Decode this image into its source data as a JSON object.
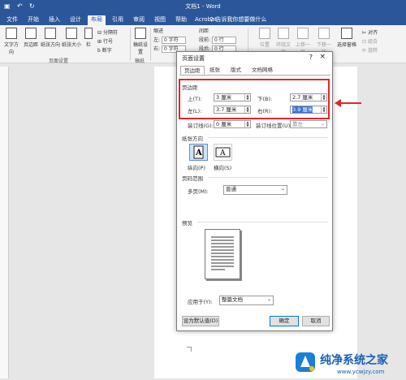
{
  "titlebar": {
    "doc_title": "文档1 - Word",
    "quick_icons": [
      "save-icon",
      "undo-icon",
      "redo-icon"
    ]
  },
  "tabs": [
    {
      "label": "文件"
    },
    {
      "label": "开始"
    },
    {
      "label": "插入"
    },
    {
      "label": "设计"
    },
    {
      "label": "布局"
    },
    {
      "label": "引用"
    },
    {
      "label": "审阅"
    },
    {
      "label": "视图"
    },
    {
      "label": "帮助"
    },
    {
      "label": "Acrobat"
    }
  ],
  "active_tab": "布局",
  "tell_me": "告诉我你想要做什么",
  "ribbon": {
    "page_setup": {
      "buttons": [
        "文字方向",
        "页边距",
        "纸张方向",
        "纸张大小",
        "栏"
      ],
      "small": [
        "分隔符",
        "行号",
        "断字"
      ],
      "label": "页面设置"
    },
    "draft": {
      "button": "稿纸设置",
      "label": "稿纸"
    },
    "indent": {
      "title": "缩进",
      "left_label": "左:",
      "left_val": "0 字符",
      "right_label": "右:",
      "right_val": "0 字符"
    },
    "spacing": {
      "title": "间距",
      "before_label": "段前:",
      "before_val": "0 行",
      "after_label": "段后:",
      "after_val": "0 行"
    },
    "arrange": [
      "位置",
      "环绕文字",
      "上移一层",
      "下移一层",
      "选择窗格"
    ],
    "align": [
      "对齐",
      "组合",
      "旋转"
    ]
  },
  "dialog": {
    "title": "页面设置",
    "help": "?",
    "close": "×",
    "tabs": [
      "页边距",
      "纸张",
      "版式",
      "文档网格"
    ],
    "margins": {
      "section": "页边距",
      "top_label": "上(T):",
      "top_val": "3 厘米",
      "bottom_label": "下(B):",
      "bottom_val": "2.7 厘米",
      "left_label": "左(L):",
      "left_val": "3.7 厘米",
      "right_label": "右(R):",
      "right_val": "3.9 厘米",
      "gutter_label": "装订线(G):",
      "gutter_val": "0 厘米",
      "gutter_pos_label": "装订线位置(U):",
      "gutter_pos_val": "靠左"
    },
    "orientation": {
      "section": "纸张方向",
      "portrait": "纵向(P)",
      "landscape": "横向(S)"
    },
    "pages": {
      "section": "页码范围",
      "multi_label": "多页(M):",
      "multi_val": "普通"
    },
    "preview": {
      "section": "预览"
    },
    "apply": {
      "label": "应用于(Y):",
      "value": "整篇文档"
    },
    "buttons": {
      "default": "设为默认值(D)",
      "ok": "确定",
      "cancel": "取消"
    }
  },
  "watermark": {
    "main": "纯净系统之家",
    "sub": "www.ycwjzy.com"
  },
  "colors": {
    "brand": "#2b579a",
    "highlight": "#e0262c",
    "selection": "#3a6fd8"
  }
}
